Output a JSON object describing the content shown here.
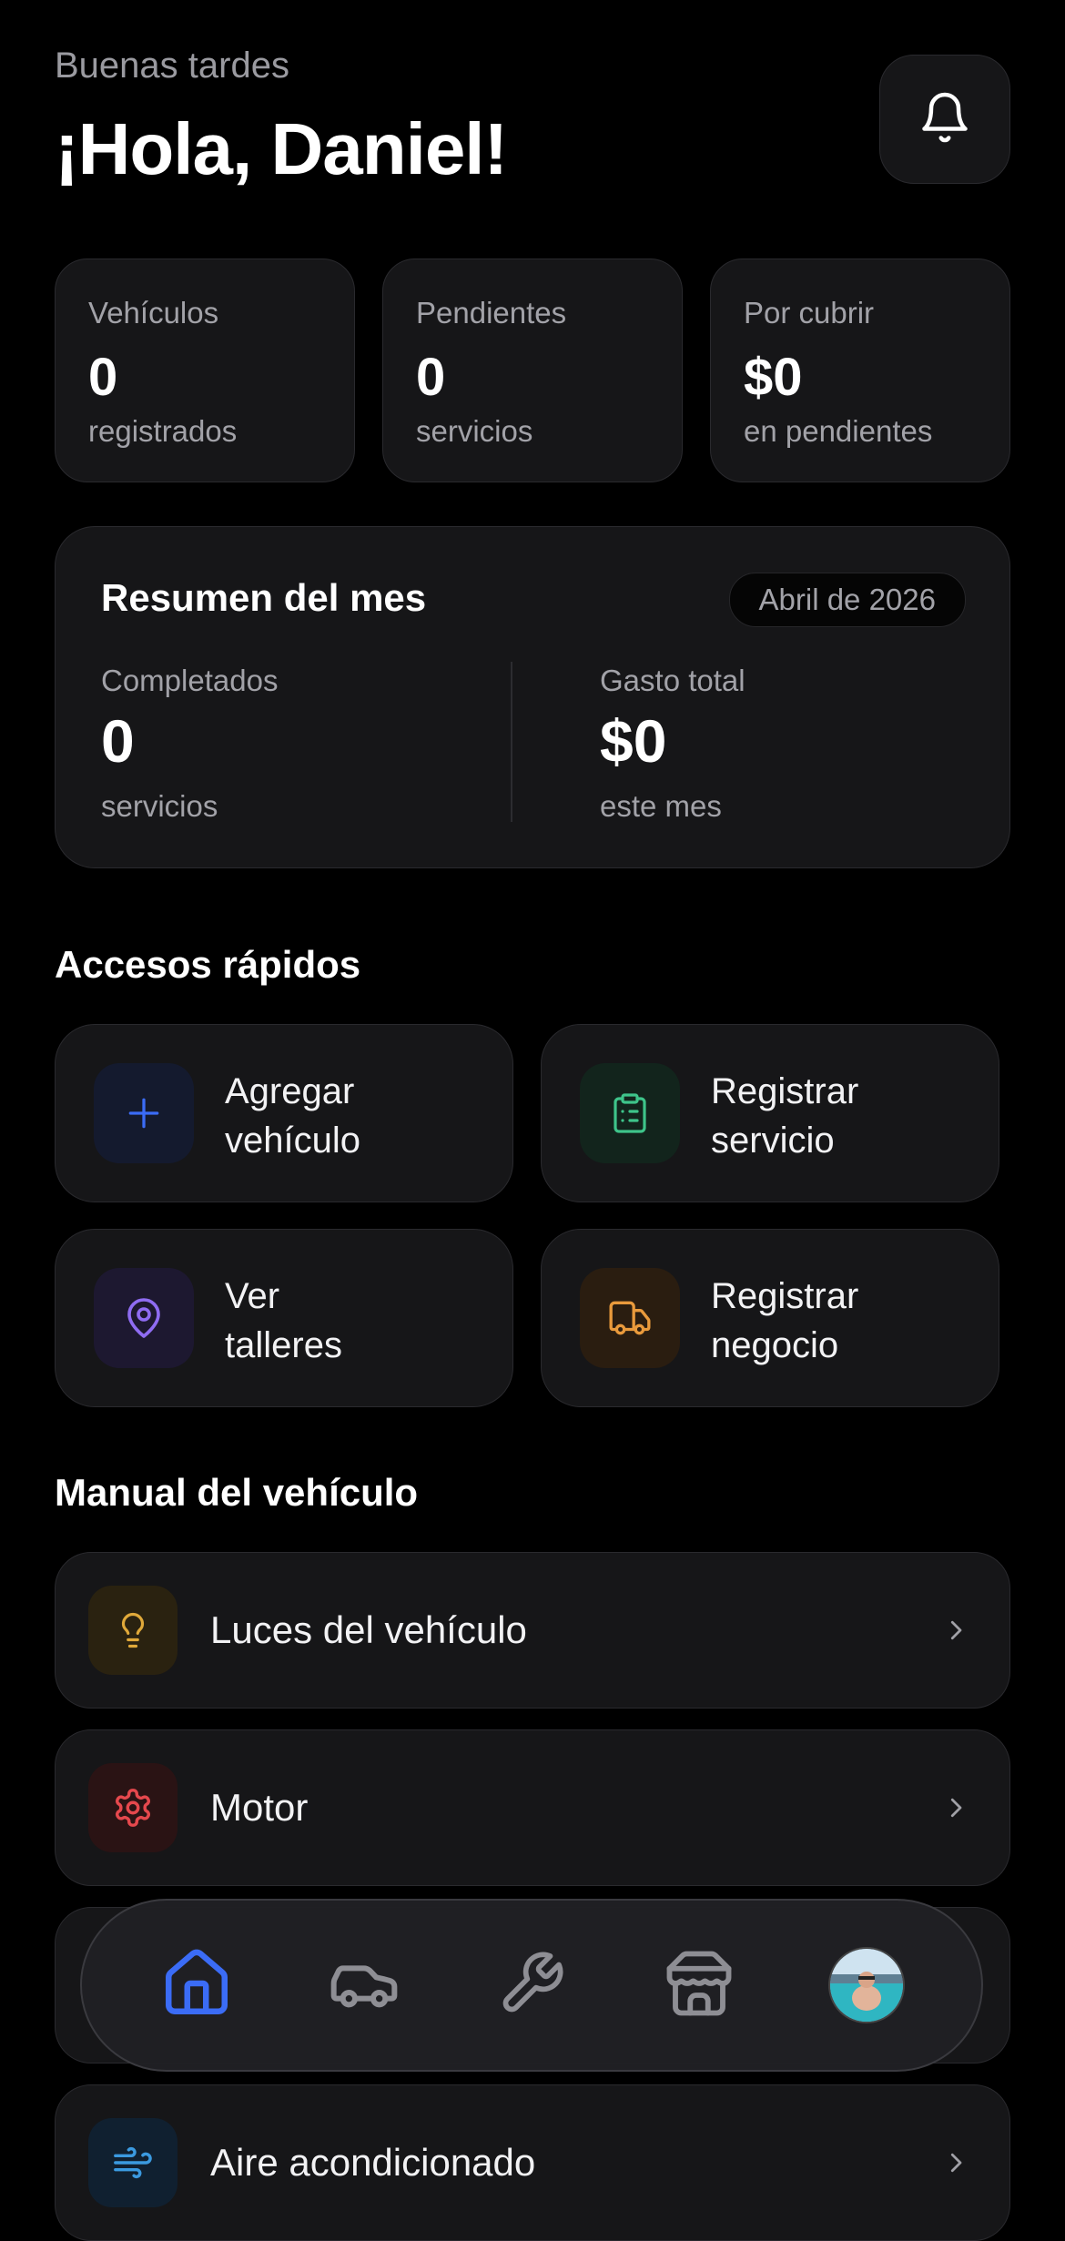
{
  "header": {
    "greeting": "Buenas tardes",
    "title": "¡Hola, Daniel!"
  },
  "stats": [
    {
      "label": "Vehículos",
      "value": "0",
      "sub": "registrados"
    },
    {
      "label": "Pendientes",
      "value": "0",
      "sub": "servicios"
    },
    {
      "label": "Por cubrir",
      "value": "$0",
      "sub": "en pendientes"
    }
  ],
  "summary": {
    "title": "Resumen del mes",
    "period": "Abril de 2026",
    "completed": {
      "label": "Completados",
      "value": "0",
      "sub": "servicios"
    },
    "spend": {
      "label": "Gasto total",
      "value": "$0",
      "sub": "este mes"
    }
  },
  "quick_access": {
    "title": "Accesos rápidos",
    "items": [
      {
        "line1": "Agregar",
        "line2": "vehículo",
        "icon": "plus-icon",
        "color": "#3b6cf6"
      },
      {
        "line1": "Registrar",
        "line2": "servicio",
        "icon": "clipboard-icon",
        "color": "#3ec48a"
      },
      {
        "line1": "Ver",
        "line2": "talleres",
        "icon": "map-pin-icon",
        "color": "#8f6cf2"
      },
      {
        "line1": "Registrar",
        "line2": "negocio",
        "icon": "truck-icon",
        "color": "#e99a3c"
      }
    ]
  },
  "manual": {
    "title": "Manual del vehículo",
    "items": [
      {
        "label": "Luces del vehículo",
        "icon": "lightbulb-icon",
        "color": "#e0a93a"
      },
      {
        "label": "Motor",
        "icon": "gear-icon",
        "color": "#e5484d"
      },
      {
        "label": "",
        "icon": "",
        "color": ""
      },
      {
        "label": "Aire acondicionado",
        "icon": "wind-icon",
        "color": "#3b9ae0"
      }
    ]
  },
  "nav": {
    "active": "home",
    "items": [
      "home-icon",
      "car-icon",
      "wrench-icon",
      "store-icon",
      "avatar"
    ],
    "accent": "#3b6cf6"
  }
}
